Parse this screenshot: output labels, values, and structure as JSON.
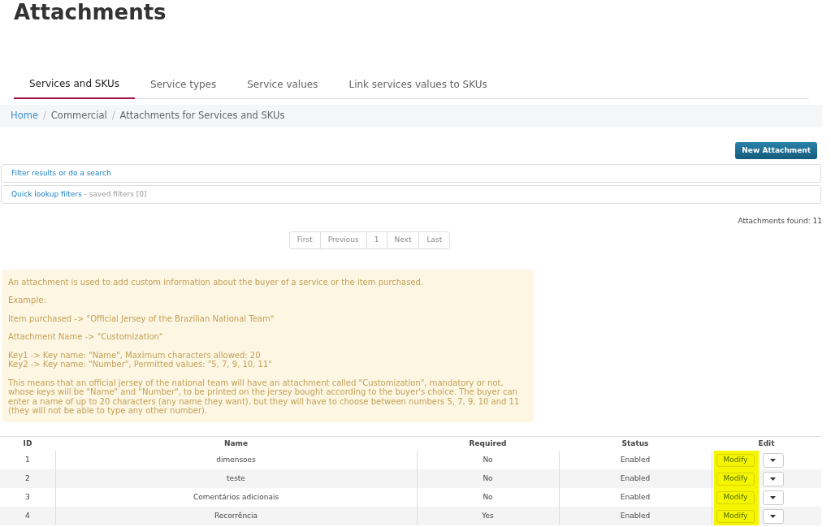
{
  "title": "Attachments",
  "tabs": [
    {
      "label": "Services and SKUs",
      "selected": true
    },
    {
      "label": "Service types",
      "selected": false
    },
    {
      "label": "Service values",
      "selected": false
    },
    {
      "label": "Link services values to SKUs",
      "selected": false
    }
  ],
  "breadcrumb": [
    {
      "label": "Home",
      "link": true
    },
    {
      "label": "Commercial",
      "link": false
    },
    {
      "label": "Attachments for Services and SKUs",
      "link": false
    }
  ],
  "breadcrumb_separator": "/",
  "new_button": "New Attachment",
  "filter_search": "Filter results or do a search",
  "quick_filters": {
    "link": "Quick lookup filters",
    "note": " - saved filters [0]"
  },
  "found": "Attachments found: 11",
  "pagination": [
    "First",
    "Previous",
    "1",
    "Next",
    "Last"
  ],
  "info": [
    "An attachment is used to add custom information about the buyer of a service or the item purchased.",
    "Example:",
    "Item purchased -> \"Official Jersey of the Brazilian National Team\"",
    "Attachment Name -> \"Customization\"",
    "Key1 -> Key name: \"Name\", Maximum characters allowed: 20\nKey2 -> Key name: \"Number\", Permitted values: \"5, 7, 9, 10, 11\"",
    "This means that an official jersey of the national team will have an attachment called \"Customization\", mandatory or not, whose keys will be \"Name\" and \"Number\", to be printed on the jersey bought according to the buyer's choice. The buyer can enter a name of up to 20 characters (any name they want), but they will have to choose between numbers 5, 7, 9, 10 and 11 (they will not be able to type any other number)."
  ],
  "table": {
    "columns": [
      "ID",
      "Name",
      "Required",
      "Status",
      "Edit"
    ],
    "rows": [
      {
        "id": "1",
        "name": "dimensoes",
        "required": "No",
        "status": "Enabled",
        "action": "Modify",
        "highlighted": true
      },
      {
        "id": "2",
        "name": "teste",
        "required": "No",
        "status": "Enabled",
        "action": "Modify",
        "highlighted": true
      },
      {
        "id": "3",
        "name": "Comentários adicionais",
        "required": "No",
        "status": "Enabled",
        "action": "Modify",
        "highlighted": true
      },
      {
        "id": "4",
        "name": "Recorrência",
        "required": "Yes",
        "status": "Enabled",
        "action": "Modify",
        "highlighted": true
      }
    ]
  }
}
